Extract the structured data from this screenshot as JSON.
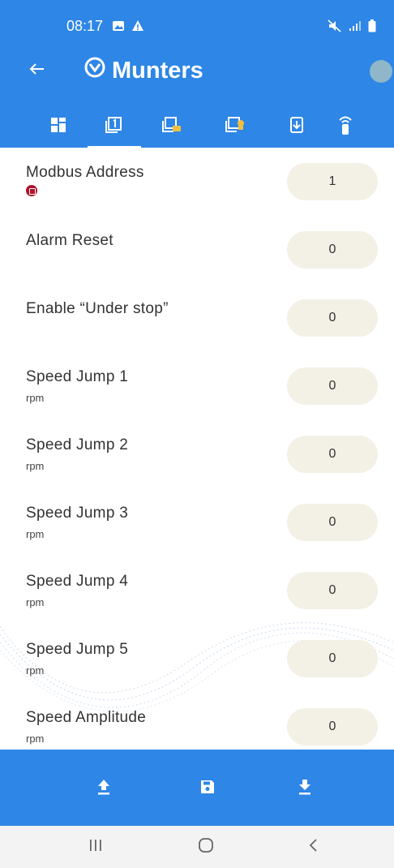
{
  "status_bar": {
    "time": "08:17",
    "left_icons": [
      "gallery-icon",
      "warning-icon"
    ],
    "right_icons": [
      "mute-icon",
      "signal-icon",
      "battery-icon"
    ]
  },
  "app_bar": {
    "brand": "Munters",
    "back_icon": "back-arrow-icon",
    "logo_icon": "munters-logo-icon",
    "avatar": "avatar"
  },
  "tabs": [
    {
      "icon": "dashboard-icon",
      "selected": false
    },
    {
      "icon": "parameter-1-icon",
      "selected": true
    },
    {
      "icon": "parameter-2-icon",
      "selected": false
    },
    {
      "icon": "parameter-lock-icon",
      "selected": false
    },
    {
      "icon": "download-device-icon",
      "selected": false
    },
    {
      "icon": "remote-icon",
      "selected": false
    }
  ],
  "parameters": [
    {
      "label": "Modbus Address",
      "unit": "",
      "value": "1",
      "warning": true
    },
    {
      "label": "Alarm Reset",
      "unit": "",
      "value": "0",
      "warning": false
    },
    {
      "label": "Enable “Under stop”",
      "unit": "",
      "value": "0",
      "warning": false
    },
    {
      "label": "Speed Jump 1",
      "unit": "rpm",
      "value": "0",
      "warning": false
    },
    {
      "label": "Speed Jump 2",
      "unit": "rpm",
      "value": "0",
      "warning": false
    },
    {
      "label": "Speed Jump 3",
      "unit": "rpm",
      "value": "0",
      "warning": false
    },
    {
      "label": "Speed Jump 4",
      "unit": "rpm",
      "value": "0",
      "warning": false
    },
    {
      "label": "Speed Jump 5",
      "unit": "rpm",
      "value": "0",
      "warning": false
    },
    {
      "label": "Speed Amplitude",
      "unit": "rpm",
      "value": "0",
      "warning": false
    }
  ],
  "bottom_actions": [
    {
      "icon": "upload-icon"
    },
    {
      "icon": "save-icon"
    },
    {
      "icon": "download-icon"
    }
  ],
  "system_nav": [
    {
      "icon": "recent-apps-icon"
    },
    {
      "icon": "home-icon"
    },
    {
      "icon": "back-nav-icon"
    }
  ],
  "colors": {
    "primary": "#2e86e6",
    "pill": "#f3f0e6",
    "warning": "#b0122a",
    "avatar": "#8fb6c9"
  }
}
